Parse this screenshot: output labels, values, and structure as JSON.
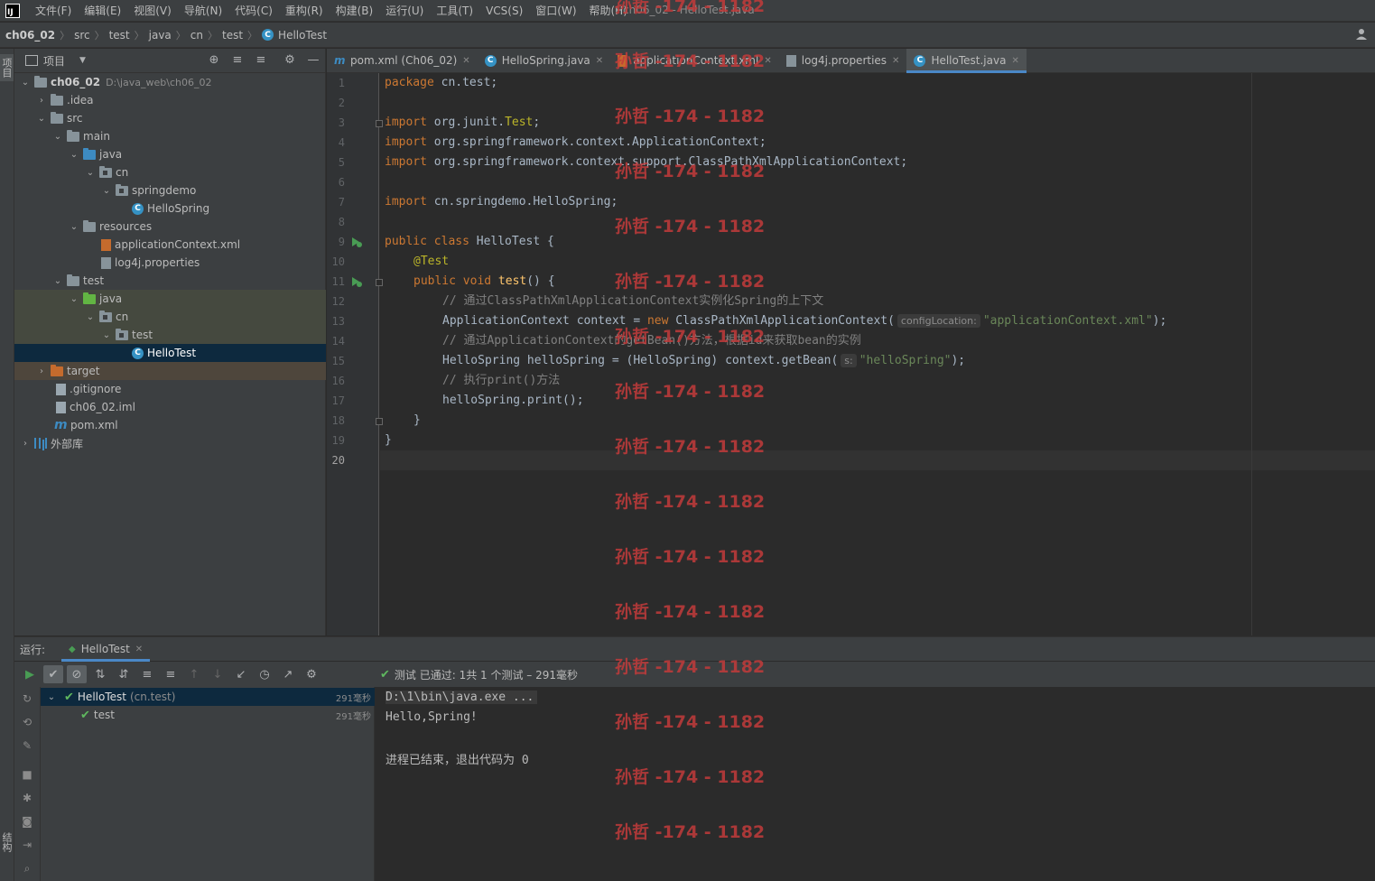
{
  "window": {
    "title": "ch06_02 - HelloTest.java",
    "logo_text": "IJ"
  },
  "menu": [
    "文件(F)",
    "编辑(E)",
    "视图(V)",
    "导航(N)",
    "代码(C)",
    "重构(R)",
    "构建(B)",
    "运行(U)",
    "工具(T)",
    "VCS(S)",
    "窗口(W)",
    "帮助(H)"
  ],
  "breadcrumb": [
    "ch06_02",
    "src",
    "test",
    "java",
    "cn",
    "test",
    "HelloTest"
  ],
  "left_strip": {
    "project_tab": "项目",
    "structure_tab": "结构"
  },
  "project_panel": {
    "title": "项目",
    "tree": [
      {
        "label": "ch06_02",
        "path": "D:\\java_web\\ch06_02",
        "icon": "folder"
      },
      {
        "label": ".idea",
        "icon": "folder"
      },
      {
        "label": "src",
        "icon": "folder"
      },
      {
        "label": "main",
        "icon": "folder"
      },
      {
        "label": "java",
        "icon": "folder-blue"
      },
      {
        "label": "cn",
        "icon": "package"
      },
      {
        "label": "springdemo",
        "icon": "package"
      },
      {
        "label": "HelloSpring",
        "icon": "class"
      },
      {
        "label": "resources",
        "icon": "folder"
      },
      {
        "label": "applicationContext.xml",
        "icon": "xml-file"
      },
      {
        "label": "log4j.properties",
        "icon": "properties-file"
      },
      {
        "label": "test",
        "icon": "folder"
      },
      {
        "label": "java",
        "icon": "folder-green"
      },
      {
        "label": "cn",
        "icon": "package"
      },
      {
        "label": "test",
        "icon": "package"
      },
      {
        "label": "HelloTest",
        "icon": "class"
      },
      {
        "label": "target",
        "icon": "folder-orange"
      },
      {
        "label": ".gitignore",
        "icon": "file"
      },
      {
        "label": "ch06_02.iml",
        "icon": "file"
      },
      {
        "label": "pom.xml",
        "icon": "maven"
      },
      {
        "label": "外部库",
        "icon": "library"
      }
    ]
  },
  "tabs": [
    {
      "label": "pom.xml (Ch06_02)",
      "icon": "maven-icon"
    },
    {
      "label": "HelloSpring.java",
      "icon": "class-icon"
    },
    {
      "label": "applicationContext.xml",
      "icon": "xml-icon"
    },
    {
      "label": "log4j.properties",
      "icon": "properties-icon"
    },
    {
      "label": "HelloTest.java",
      "icon": "class-icon",
      "active": true
    }
  ],
  "editor": {
    "line_numbers": [
      "1",
      "2",
      "3",
      "4",
      "5",
      "6",
      "7",
      "8",
      "9",
      "10",
      "11",
      "12",
      "13",
      "14",
      "15",
      "16",
      "17",
      "18",
      "19",
      "20"
    ],
    "code": {
      "l1_kw": "package",
      "l1_rest": " cn.test;",
      "l3_kw": "import",
      "l3_rest": " org.junit.",
      "l3_ann": "Test",
      "l3_end": ";",
      "l4_kw": "import",
      "l4_rest": " org.springframework.context.ApplicationContext;",
      "l5_kw": "import",
      "l5_rest": " org.springframework.context.support.ClassPathXmlApplicationContext;",
      "l7_kw": "import",
      "l7_rest": " cn.springdemo.HelloSpring;",
      "l9_kw": "public class",
      "l9_rest": " HelloTest {",
      "l10_ann": "@Test",
      "l11_kw": "public void",
      "l11_fn": "test",
      "l11_rest": "() {",
      "l12_cmt": "// 通过ClassPathXmlApplicationContext实例化Spring的上下文",
      "l13_a": "ApplicationContext context = ",
      "l13_kw": "new",
      "l13_b": " ClassPathXmlApplicationContext(",
      "l13_hint": "configLocation:",
      "l13_str": "\"applicationContext.xml\"",
      "l13_end": ");",
      "l14_cmt": "// 通过ApplicationContext的getBean()方法，根据id来获取bean的实例",
      "l15_a": "HelloSpring helloSpring = (HelloSpring) context.getBean(",
      "l15_hint": "s:",
      "l15_str": "\"helloSpring\"",
      "l15_end": ");",
      "l16_cmt": "// 执行print()方法",
      "l17": "helloSpring.print();",
      "l18": "}",
      "l19": "}"
    }
  },
  "run_panel": {
    "label": "运行:",
    "tab": "HelloTest",
    "status": "测试 已通过: 1共 1 个测试 – 291毫秒",
    "tests": [
      {
        "name": "HelloTest",
        "detail": "(cn.test)",
        "time": "291毫秒"
      },
      {
        "name": "test",
        "time": "291毫秒"
      }
    ],
    "console": [
      "D:\\1\\bin\\java.exe ...",
      "Hello,Spring!",
      "",
      "进程已结束，退出代码为 0"
    ]
  },
  "watermark": "孙哲 -174 - 1182",
  "colors": {
    "accent": "#4a88c7",
    "pass": "#5fb85f",
    "watermark": "#c23b3b"
  }
}
